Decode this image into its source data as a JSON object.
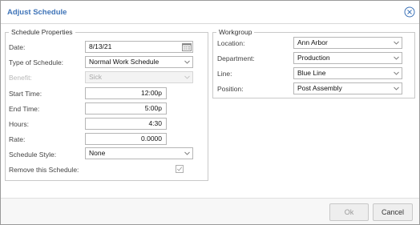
{
  "dialog": {
    "title": "Adjust Schedule",
    "close_icon": "close-circle-icon"
  },
  "schedule_properties": {
    "legend": "Schedule Properties",
    "date": {
      "label": "Date:",
      "value": "8/13/21",
      "icon": "calendar-icon"
    },
    "type_of_schedule": {
      "label": "Type of Schedule:",
      "value": "Normal Work Schedule"
    },
    "benefit": {
      "label": "Benefit:",
      "value": "Sick",
      "disabled": true
    },
    "start_time": {
      "label": "Start Time:",
      "value": "12:00p"
    },
    "end_time": {
      "label": "End Time:",
      "value": "5:00p"
    },
    "hours": {
      "label": "Hours:",
      "value": "4:30"
    },
    "rate": {
      "label": "Rate:",
      "value": "0.0000"
    },
    "schedule_style": {
      "label": "Schedule Style:",
      "value": "None"
    },
    "remove_schedule": {
      "label": "Remove this Schedule:",
      "checked": true,
      "disabled": true
    }
  },
  "workgroup": {
    "legend": "Workgroup",
    "location": {
      "label": "Location:",
      "value": "Ann Arbor"
    },
    "department": {
      "label": "Department:",
      "value": "Production"
    },
    "line": {
      "label": "Line:",
      "value": "Blue Line"
    },
    "position": {
      "label": "Position:",
      "value": "Post Assembly"
    }
  },
  "footer": {
    "ok_label": "Ok",
    "ok_disabled": true,
    "cancel_label": "Cancel"
  },
  "colors": {
    "title": "#3f74b8",
    "disabled_text": "#b8b8b8",
    "border": "#c9c9c9"
  }
}
